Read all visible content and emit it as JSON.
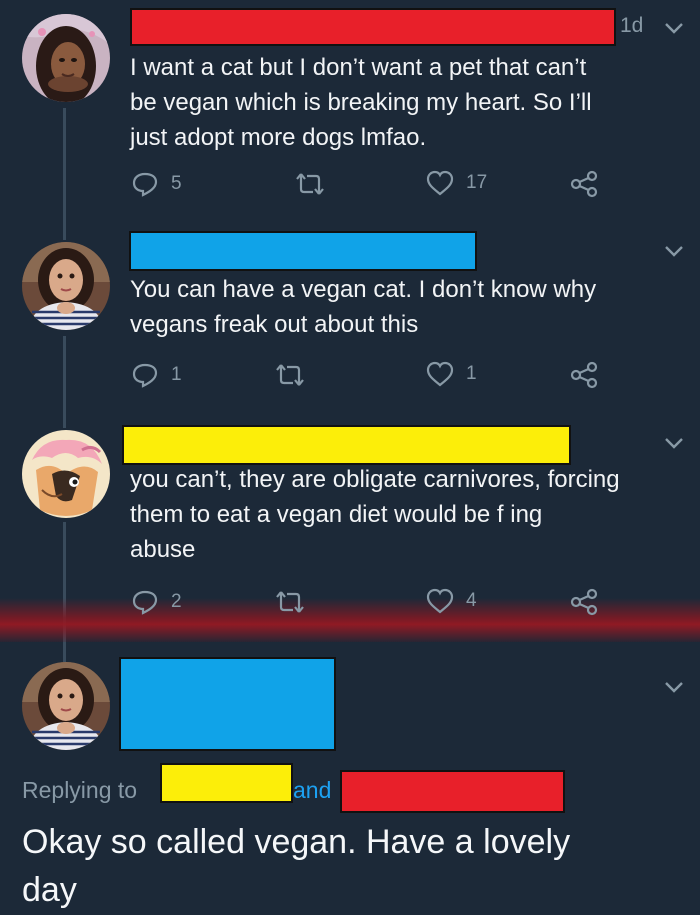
{
  "colors": {
    "background": "#1c2938",
    "muted": "#8899a6",
    "link": "#1da1f2",
    "redaction_red": "#e8202a",
    "redaction_blue": "#10a3e8",
    "redaction_yellow": "#fcee09",
    "separator_glow": "#96192a"
  },
  "tweets": [
    {
      "time": "1d",
      "text": "I want a cat but I don’t want a pet that can’t\nbe vegan which is breaking my heart. So I’ll\njust adopt more dogs lmfao.",
      "reply_count": "5",
      "like_count": "17",
      "icons": [
        "reply-icon",
        "retweet-icon",
        "like-icon",
        "share-icon",
        "chevron-down-icon"
      ]
    },
    {
      "text": "You can have a vegan cat. I don’t know why\nvegans freak out about this",
      "reply_count": "1",
      "like_count": "1"
    },
    {
      "text": "you can’t, they are obligate carnivores, forcing\nthem to eat a vegan diet would be f      ing\nabuse",
      "reply_count": "2",
      "like_count": "4"
    }
  ],
  "main_tweet": {
    "replying_prefix": "Replying to",
    "replying_and": "and",
    "text": "Okay so called vegan. Have a lovely\nday"
  }
}
